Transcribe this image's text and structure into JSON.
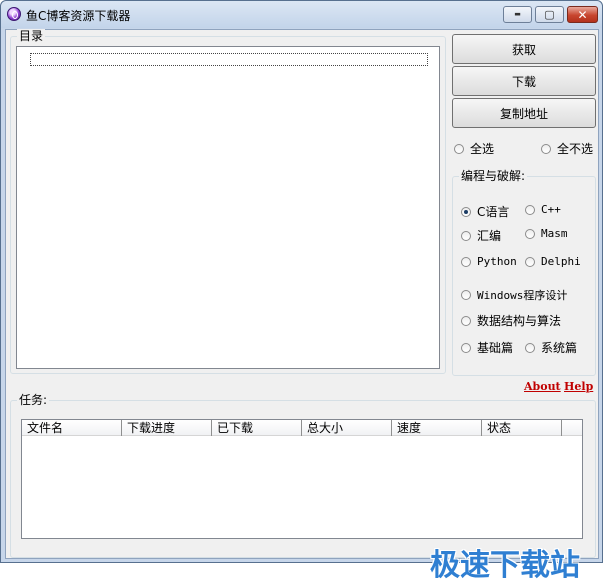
{
  "window": {
    "title": "鱼C博客资源下载器",
    "controls": {
      "minimize": "▬",
      "maximize": "▢",
      "close": "✕"
    }
  },
  "directory": {
    "label": "目录"
  },
  "actions": {
    "fetch": "获取",
    "download": "下载",
    "copy_address": "复制地址"
  },
  "selection": {
    "select_all": "全选",
    "select_none": "全不选"
  },
  "categories": {
    "label": "编程与破解:",
    "items": {
      "c_lang": "C语言",
      "cpp": "C++",
      "asm": "汇编",
      "masm": "Masm",
      "python": "Python",
      "delphi": "Delphi",
      "windows": "Windows程序设计",
      "dsa": "数据结构与算法",
      "basic": "基础篇",
      "system": "系统篇"
    },
    "selected": "c_lang"
  },
  "links": {
    "about": "About",
    "help": "Help"
  },
  "tasks": {
    "label": "任务:",
    "columns": [
      "文件名",
      "下载进度",
      "已下载",
      "总大小",
      "速度",
      "状态"
    ]
  },
  "watermark": "极速下载站",
  "colors": {
    "link": "#c00000",
    "watermark": "#2f7fd2"
  }
}
